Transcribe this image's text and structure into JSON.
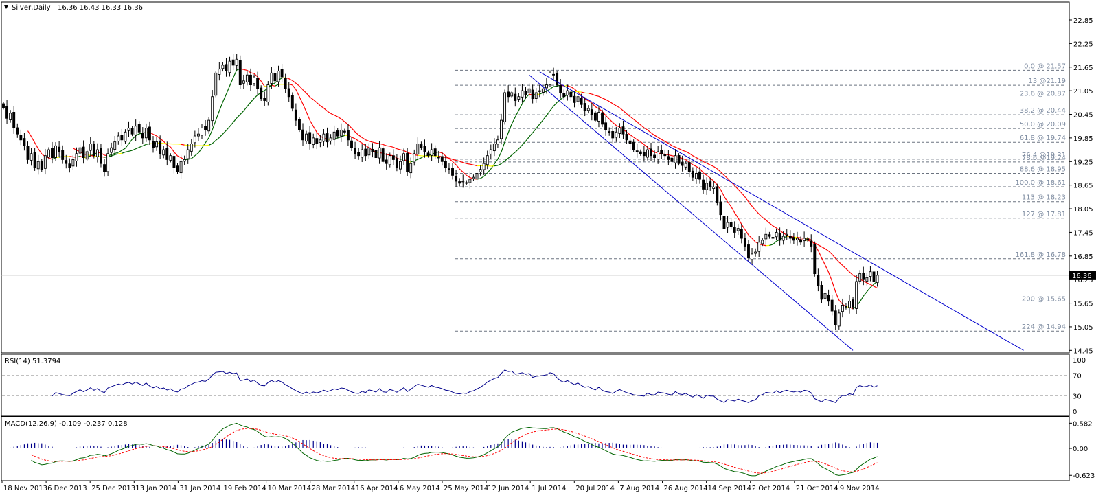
{
  "header": {
    "symbol": "Silver,Daily",
    "ohlc": "16.36 16.43 16.33 16.36"
  },
  "colors": {
    "background": "#ffffff",
    "bull_body": "#ffffff",
    "bear_body": "#000000",
    "ma_rising": "#006400",
    "ma_falling": "#ff0000",
    "ma_flat": "#ffff00",
    "channel": "#0000cd",
    "fib_line": "#6b7380",
    "fib_text": "#7d8ba0",
    "rsi_line": "#00008b",
    "macd_line": "#006400",
    "macd_signal": "#ff0000",
    "macd_hist": "#00008b",
    "price_label_bg": "#000000"
  },
  "chart_data": [
    {
      "type": "candlestick",
      "title": "Silver,Daily",
      "current_price": "16.36",
      "ylim": [
        14.45,
        22.85
      ],
      "y_ticks": [
        "22.85",
        "22.25",
        "21.65",
        "21.05",
        "20.45",
        "19.85",
        "19.25",
        "18.65",
        "18.05",
        "17.45",
        "16.85",
        "16.25",
        "15.65",
        "15.05",
        "14.45"
      ],
      "x_ticks": [
        "18 Nov 2013",
        "6 Dec 2013",
        "25 Dec 2013",
        "13 Jan 2014",
        "31 Jan 2014",
        "19 Feb 2014",
        "10 Mar 2014",
        "28 Mar 2014",
        "16 Apr 2014",
        "6 May 2014",
        "25 May 2014",
        "12 Jun 2014",
        "1 Jul 2014",
        "20 Jul 2014",
        "7 Aug 2014",
        "26 Aug 2014",
        "14 Sep 2014",
        "2 Oct 2014",
        "21 Oct 2014",
        "9 Nov 2014"
      ],
      "close": [
        20.62,
        20.35,
        20.48,
        20.1,
        19.95,
        19.8,
        19.65,
        19.3,
        19.45,
        19.1,
        19.25,
        19.05,
        19.4,
        19.55,
        19.35,
        19.65,
        19.5,
        19.3,
        19.2,
        19.1,
        19.3,
        19.45,
        19.6,
        19.35,
        19.5,
        19.7,
        19.4,
        19.55,
        19.2,
        19.0,
        19.45,
        19.6,
        19.75,
        19.9,
        19.8,
        20.0,
        20.1,
        19.95,
        20.15,
        20.0,
        19.85,
        20.1,
        19.8,
        19.6,
        19.75,
        19.45,
        19.55,
        19.3,
        19.4,
        19.1,
        19.0,
        19.25,
        19.3,
        19.55,
        19.7,
        19.9,
        19.95,
        20.1,
        20.05,
        20.3,
        20.9,
        21.5,
        21.6,
        21.7,
        21.55,
        21.8,
        21.7,
        21.85,
        21.2,
        21.3,
        21.45,
        21.2,
        21.4,
        21.1,
        20.85,
        20.8,
        21.2,
        21.5,
        21.3,
        21.55,
        21.4,
        21.1,
        20.9,
        20.6,
        20.3,
        20.05,
        19.8,
        19.95,
        19.7,
        19.85,
        19.7,
        19.8,
        19.95,
        19.75,
        19.85,
        20.0,
        19.9,
        20.05,
        20.0,
        19.8,
        19.6,
        19.45,
        19.4,
        19.55,
        19.4,
        19.6,
        19.5,
        19.35,
        19.6,
        19.25,
        19.2,
        19.4,
        19.3,
        19.1,
        19.25,
        19.45,
        19.0,
        19.2,
        19.45,
        19.7,
        19.6,
        19.5,
        19.4,
        19.55,
        19.4,
        19.35,
        19.25,
        19.1,
        19.05,
        18.9,
        18.75,
        18.7,
        18.75,
        18.7,
        18.8,
        18.85,
        18.95,
        19.05,
        19.2,
        19.4,
        19.55,
        19.7,
        19.8,
        20.3,
        21.0,
        20.9,
        21.0,
        20.8,
        20.9,
        21.05,
        20.95,
        21.1,
        20.85,
        21.0,
        21.05,
        21.1,
        21.2,
        21.5,
        21.45,
        21.2,
        21.0,
        20.9,
        21.05,
        20.9,
        20.75,
        20.9,
        20.7,
        20.55,
        20.6,
        20.45,
        20.3,
        20.5,
        20.2,
        20.05,
        20.0,
        19.85,
        20.0,
        20.1,
        19.95,
        19.8,
        19.7,
        19.55,
        19.5,
        19.45,
        19.4,
        19.55,
        19.4,
        19.35,
        19.5,
        19.45,
        19.4,
        19.3,
        19.25,
        19.4,
        19.2,
        19.15,
        19.2,
        19.0,
        18.85,
        18.95,
        18.8,
        18.55,
        18.7,
        18.6,
        18.6,
        18.2,
        17.9,
        17.55,
        17.7,
        17.6,
        17.45,
        17.55,
        17.3,
        17.1,
        16.8,
        16.9,
        16.95,
        17.2,
        17.25,
        17.4,
        17.35,
        17.3,
        17.45,
        17.25,
        17.35,
        17.4,
        17.3,
        17.25,
        17.3,
        17.2,
        17.3,
        17.25,
        17.1,
        16.4,
        16.1,
        15.75,
        15.9,
        15.7,
        15.45,
        15.1,
        15.4,
        15.6,
        15.55,
        15.7,
        15.55,
        16.2,
        16.4,
        16.25,
        16.3,
        16.45,
        16.2,
        16.36
      ],
      "fibonacci": [
        {
          "price": 21.57,
          "label": "0.0 @ 21.57"
        },
        {
          "price": 21.19,
          "label": "13 @21.19"
        },
        {
          "price": 20.87,
          "label": "23.6 @ 20.87"
        },
        {
          "price": 20.44,
          "label": "38.2 @ 20.44"
        },
        {
          "price": 20.09,
          "label": "50.0 @ 20.09"
        },
        {
          "price": 19.74,
          "label": "61.8 @ 19.74"
        },
        {
          "price": 19.31,
          "label": "76.4 @19.31"
        },
        {
          "price": 19.24,
          "label": "78.6 @19.24"
        },
        {
          "price": 18.95,
          "label": "88.6 @ 18.95"
        },
        {
          "price": 18.61,
          "label": "100.0 @ 18.61"
        },
        {
          "price": 18.23,
          "label": "113 @ 18.23"
        },
        {
          "price": 17.81,
          "label": "127 @ 17.81"
        },
        {
          "price": 16.78,
          "label": "161.8 @ 16.78"
        },
        {
          "price": 15.65,
          "label": "200 @ 15.65"
        },
        {
          "price": 14.94,
          "label": "224 @ 14.94"
        }
      ],
      "channel": [
        {
          "from": {
            "bar": 154,
            "price": 21.53
          },
          "to": {
            "bar": 293,
            "price": 14.45
          }
        },
        {
          "from": {
            "bar": 151,
            "price": 21.45
          },
          "to": {
            "bar": 244,
            "price": 14.45
          }
        }
      ]
    },
    {
      "type": "line",
      "title": "RSI(14) 51.3794",
      "ylim": [
        0,
        100
      ],
      "y_ticks": [
        "100",
        "70",
        "30",
        "0"
      ],
      "levels": [
        70,
        30
      ],
      "period": 14
    },
    {
      "type": "line",
      "title": "MACD(12,26,9) -0.109 -0.237 0.128",
      "ylim": [
        -0.623,
        0.582
      ],
      "y_ticks": [
        "0.582",
        "0.00",
        "-0.623"
      ],
      "params": [
        12,
        26,
        9
      ]
    }
  ]
}
